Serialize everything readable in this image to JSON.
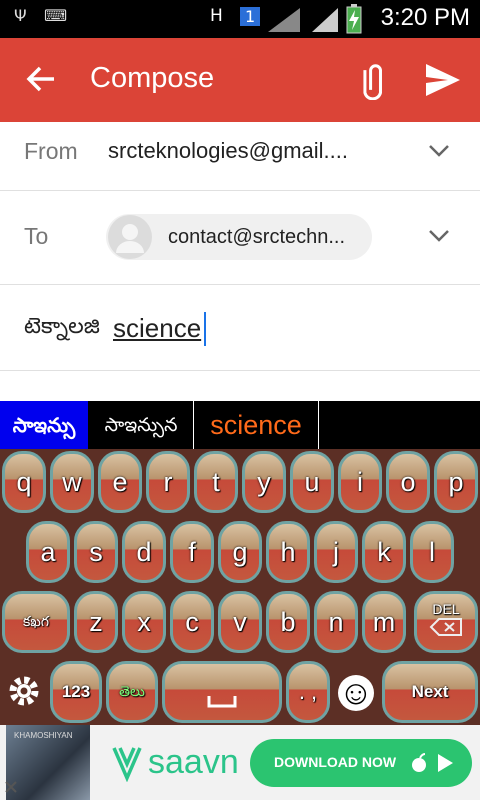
{
  "status_bar": {
    "time": "3:20 PM",
    "network_letter": "H",
    "sim_badge": "1",
    "icons": [
      "usb-icon",
      "keyboard-icon",
      "data-arrows-icon",
      "signal-icon",
      "battery-charging-icon"
    ]
  },
  "app_bar": {
    "title": "Compose",
    "back_icon": "arrow-back-icon",
    "attach_icon": "paperclip-icon",
    "send_icon": "send-icon",
    "color": "#db4437"
  },
  "from": {
    "label": "From",
    "value": "srcteknologies@gmail...."
  },
  "to": {
    "label": "To",
    "chip": "contact@srctechn..."
  },
  "subject": {
    "telugu": "టెక్నాలజి",
    "word": "science"
  },
  "suggestions": [
    "సాఇన్సు",
    "సాఇన్సున",
    "science"
  ],
  "keyboard": {
    "row1": [
      "q",
      "w",
      "e",
      "r",
      "t",
      "y",
      "u",
      "i",
      "o",
      "p"
    ],
    "row2": [
      "a",
      "s",
      "d",
      "f",
      "g",
      "h",
      "j",
      "k",
      "l"
    ],
    "row3": [
      "కఖగ",
      "z",
      "x",
      "c",
      "v",
      "b",
      "n",
      "m",
      "DEL"
    ],
    "row4": {
      "settings": "gear-icon",
      "numbers": "123",
      "lang": "తెలు",
      "space": "space",
      "punct": ". ,",
      "emoji": "☺",
      "next": "Next"
    }
  },
  "ad": {
    "thumb_text": "KHAMOSHIYAN",
    "brand": "saavn",
    "cta": "DOWNLOAD NOW",
    "brand_color": "#2bc470"
  }
}
